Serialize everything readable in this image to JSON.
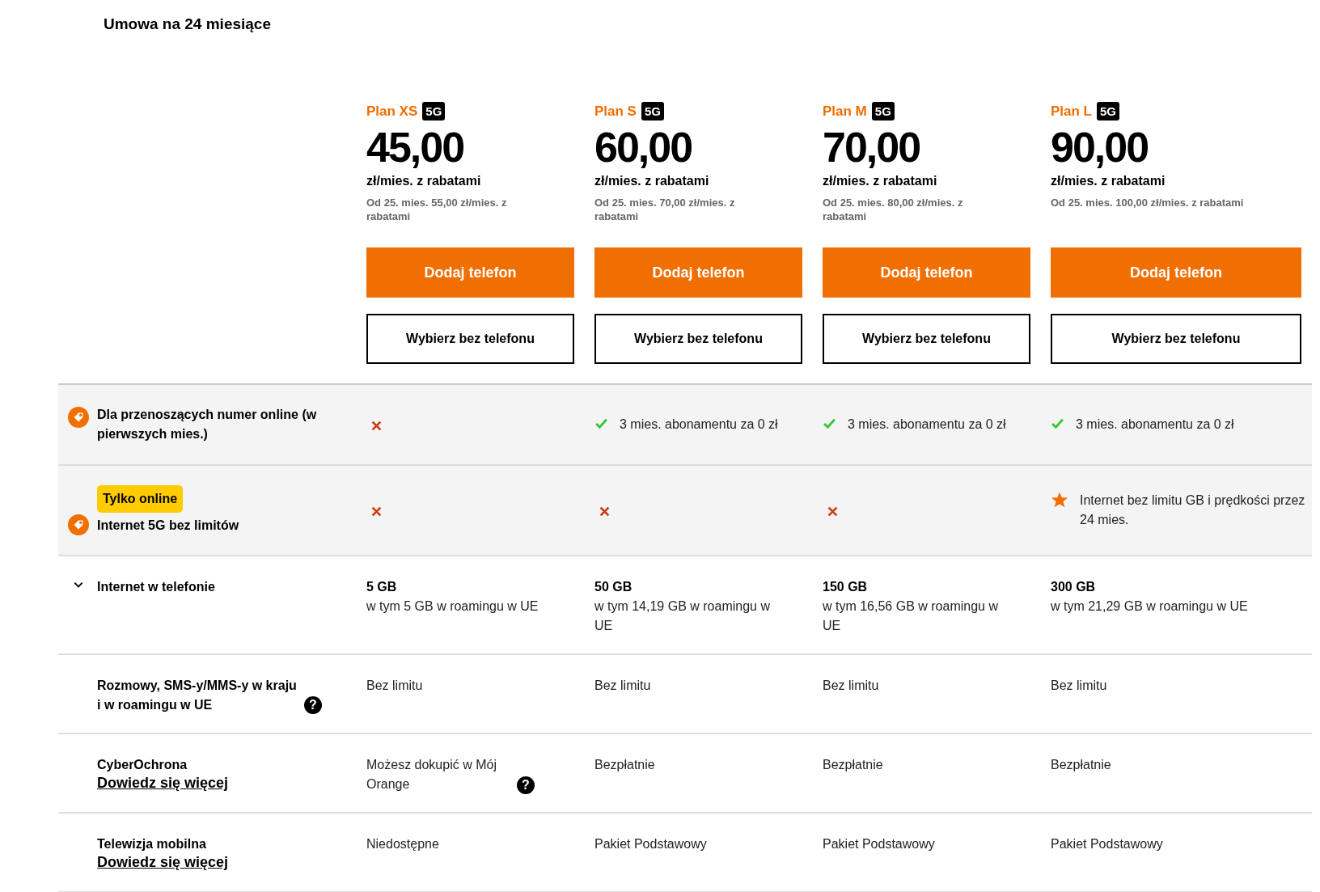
{
  "title": "Umowa na 24 miesiące",
  "plans": [
    {
      "name": "Plan XS",
      "badge": "5G",
      "price": "45,00",
      "unit": "zł/mies. z rabatami",
      "note": "Od 25. mies. 55,00 zł/mies. z rabatami",
      "primary": "Dodaj telefon",
      "secondary": "Wybierz bez telefonu"
    },
    {
      "name": "Plan S",
      "badge": "5G",
      "price": "60,00",
      "unit": "zł/mies. z rabatami",
      "note": "Od 25. mies. 70,00 zł/mies. z rabatami",
      "primary": "Dodaj telefon",
      "secondary": "Wybierz bez telefonu"
    },
    {
      "name": "Plan M",
      "badge": "5G",
      "price": "70,00",
      "unit": "zł/mies. z rabatami",
      "note": "Od 25. mies. 80,00 zł/mies. z rabatami",
      "primary": "Dodaj telefon",
      "secondary": "Wybierz bez telefonu"
    },
    {
      "name": "Plan L",
      "badge": "5G",
      "price": "90,00",
      "unit": "zł/mies. z rabatami",
      "note": "Od 25. mies. 100,00 zł/mies. z rabatami",
      "primary": "Dodaj telefon",
      "secondary": "Wybierz bez telefonu"
    }
  ],
  "features": [
    {
      "label": "Dla przenoszących numer online (w pierwszych mies.)",
      "kind": "promo",
      "shaded": true,
      "cells": [
        {
          "kind": "cross"
        },
        {
          "kind": "check",
          "text": "3 mies. abonamentu za 0 zł"
        },
        {
          "kind": "check",
          "text": "3 mies. abonamentu za 0 zł"
        },
        {
          "kind": "check",
          "text": "3 mies. abonamentu za 0 zł"
        }
      ]
    },
    {
      "label": "Internet 5G bez limitów",
      "badge": "Tylko online",
      "kind": "promo",
      "shaded": true,
      "cells": [
        {
          "kind": "cross"
        },
        {
          "kind": "cross"
        },
        {
          "kind": "cross"
        },
        {
          "kind": "star",
          "text": "Internet bez limitu GB i prędkości przez 24 mies."
        }
      ]
    },
    {
      "label": "Internet w telefonie",
      "kind": "expandable",
      "expanded": true,
      "shaded": false,
      "cells": [
        {
          "kind": "amount",
          "text": "5 GB",
          "sub": "w tym 5 GB w roamingu w UE"
        },
        {
          "kind": "amount",
          "text": "50 GB",
          "sub": "w tym 14,19 GB w roamingu w UE"
        },
        {
          "kind": "amount",
          "text": "150 GB",
          "sub": "w tym 16,56 GB w roamingu w UE"
        },
        {
          "kind": "amount",
          "text": "300 GB",
          "sub": "w tym 21,29 GB w roamingu w UE"
        }
      ]
    },
    {
      "label": "Rozmowy, SMS-y/MMS-y w kraju i w roamingu w UE",
      "kind": "plain",
      "help": "?",
      "shaded": false,
      "cells": [
        {
          "kind": "text",
          "text": "Bez limitu"
        },
        {
          "kind": "text",
          "text": "Bez limitu"
        },
        {
          "kind": "text",
          "text": "Bez limitu"
        },
        {
          "kind": "text",
          "text": "Bez limitu"
        }
      ]
    },
    {
      "label": "CyberOchrona",
      "kind": "plain",
      "link": "Dowiedz się więcej",
      "shaded": false,
      "cells": [
        {
          "kind": "text",
          "text": "Możesz dokupić w Mój Orange",
          "help": "?"
        },
        {
          "kind": "text",
          "text": "Bezpłatnie"
        },
        {
          "kind": "text",
          "text": "Bezpłatnie"
        },
        {
          "kind": "text",
          "text": "Bezpłatnie"
        }
      ]
    },
    {
      "label": "Telewizja mobilna",
      "kind": "plain",
      "link": "Dowiedz się więcej",
      "shaded": false,
      "cells": [
        {
          "kind": "text",
          "text": "Niedostępne"
        },
        {
          "kind": "text",
          "text": "Pakiet Podstawowy"
        },
        {
          "kind": "text",
          "text": "Pakiet Podstawowy"
        },
        {
          "kind": "text",
          "text": "Pakiet Podstawowy"
        }
      ]
    }
  ]
}
